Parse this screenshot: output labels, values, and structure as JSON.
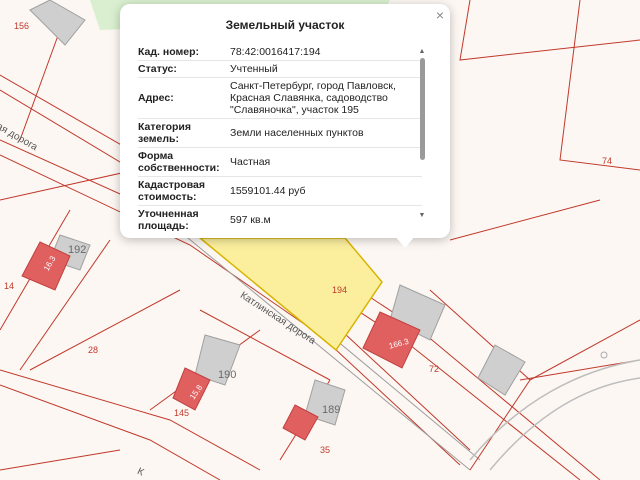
{
  "popup": {
    "title": "Земельный участок",
    "close_symbol": "×",
    "rows": [
      {
        "label": "Кад. номер:",
        "value": "78:42:0016417:194"
      },
      {
        "label": "Статус:",
        "value": "Учтенный"
      },
      {
        "label": "Адрес:",
        "value": "Санкт-Петербург, город Павловск, Красная Славянка, садоводство \"Славяночка\", участок 195"
      },
      {
        "label": "Категория земель:",
        "value": "Земли населенных пунктов"
      },
      {
        "label": "Форма собственности:",
        "value": "Частная"
      },
      {
        "label": "Кадастровая стоимость:",
        "value": "1559101.44 руб"
      },
      {
        "label": "Уточненная площадь:",
        "value": "597 кв.м"
      }
    ],
    "scroll_up_symbol": "▲",
    "scroll_down_symbol": "▼"
  },
  "map": {
    "parcel_labels": [
      "156",
      "14",
      "28",
      "145",
      "35",
      "72",
      "74",
      "194"
    ],
    "building_numbers": [
      "192",
      "190",
      "189"
    ],
    "house_numbers": [
      "16.3",
      "15.8",
      "166.3"
    ],
    "road_labels": [
      "Катлинская дорога",
      "ая дорога",
      "К"
    ],
    "colors": {
      "selected_parcel": "#fbef9e",
      "selected_outline": "#d8b400",
      "boundary": "#c0392b",
      "building": "#cfcfcf",
      "house": "#e06060",
      "green_area": "#d9efcf"
    }
  }
}
